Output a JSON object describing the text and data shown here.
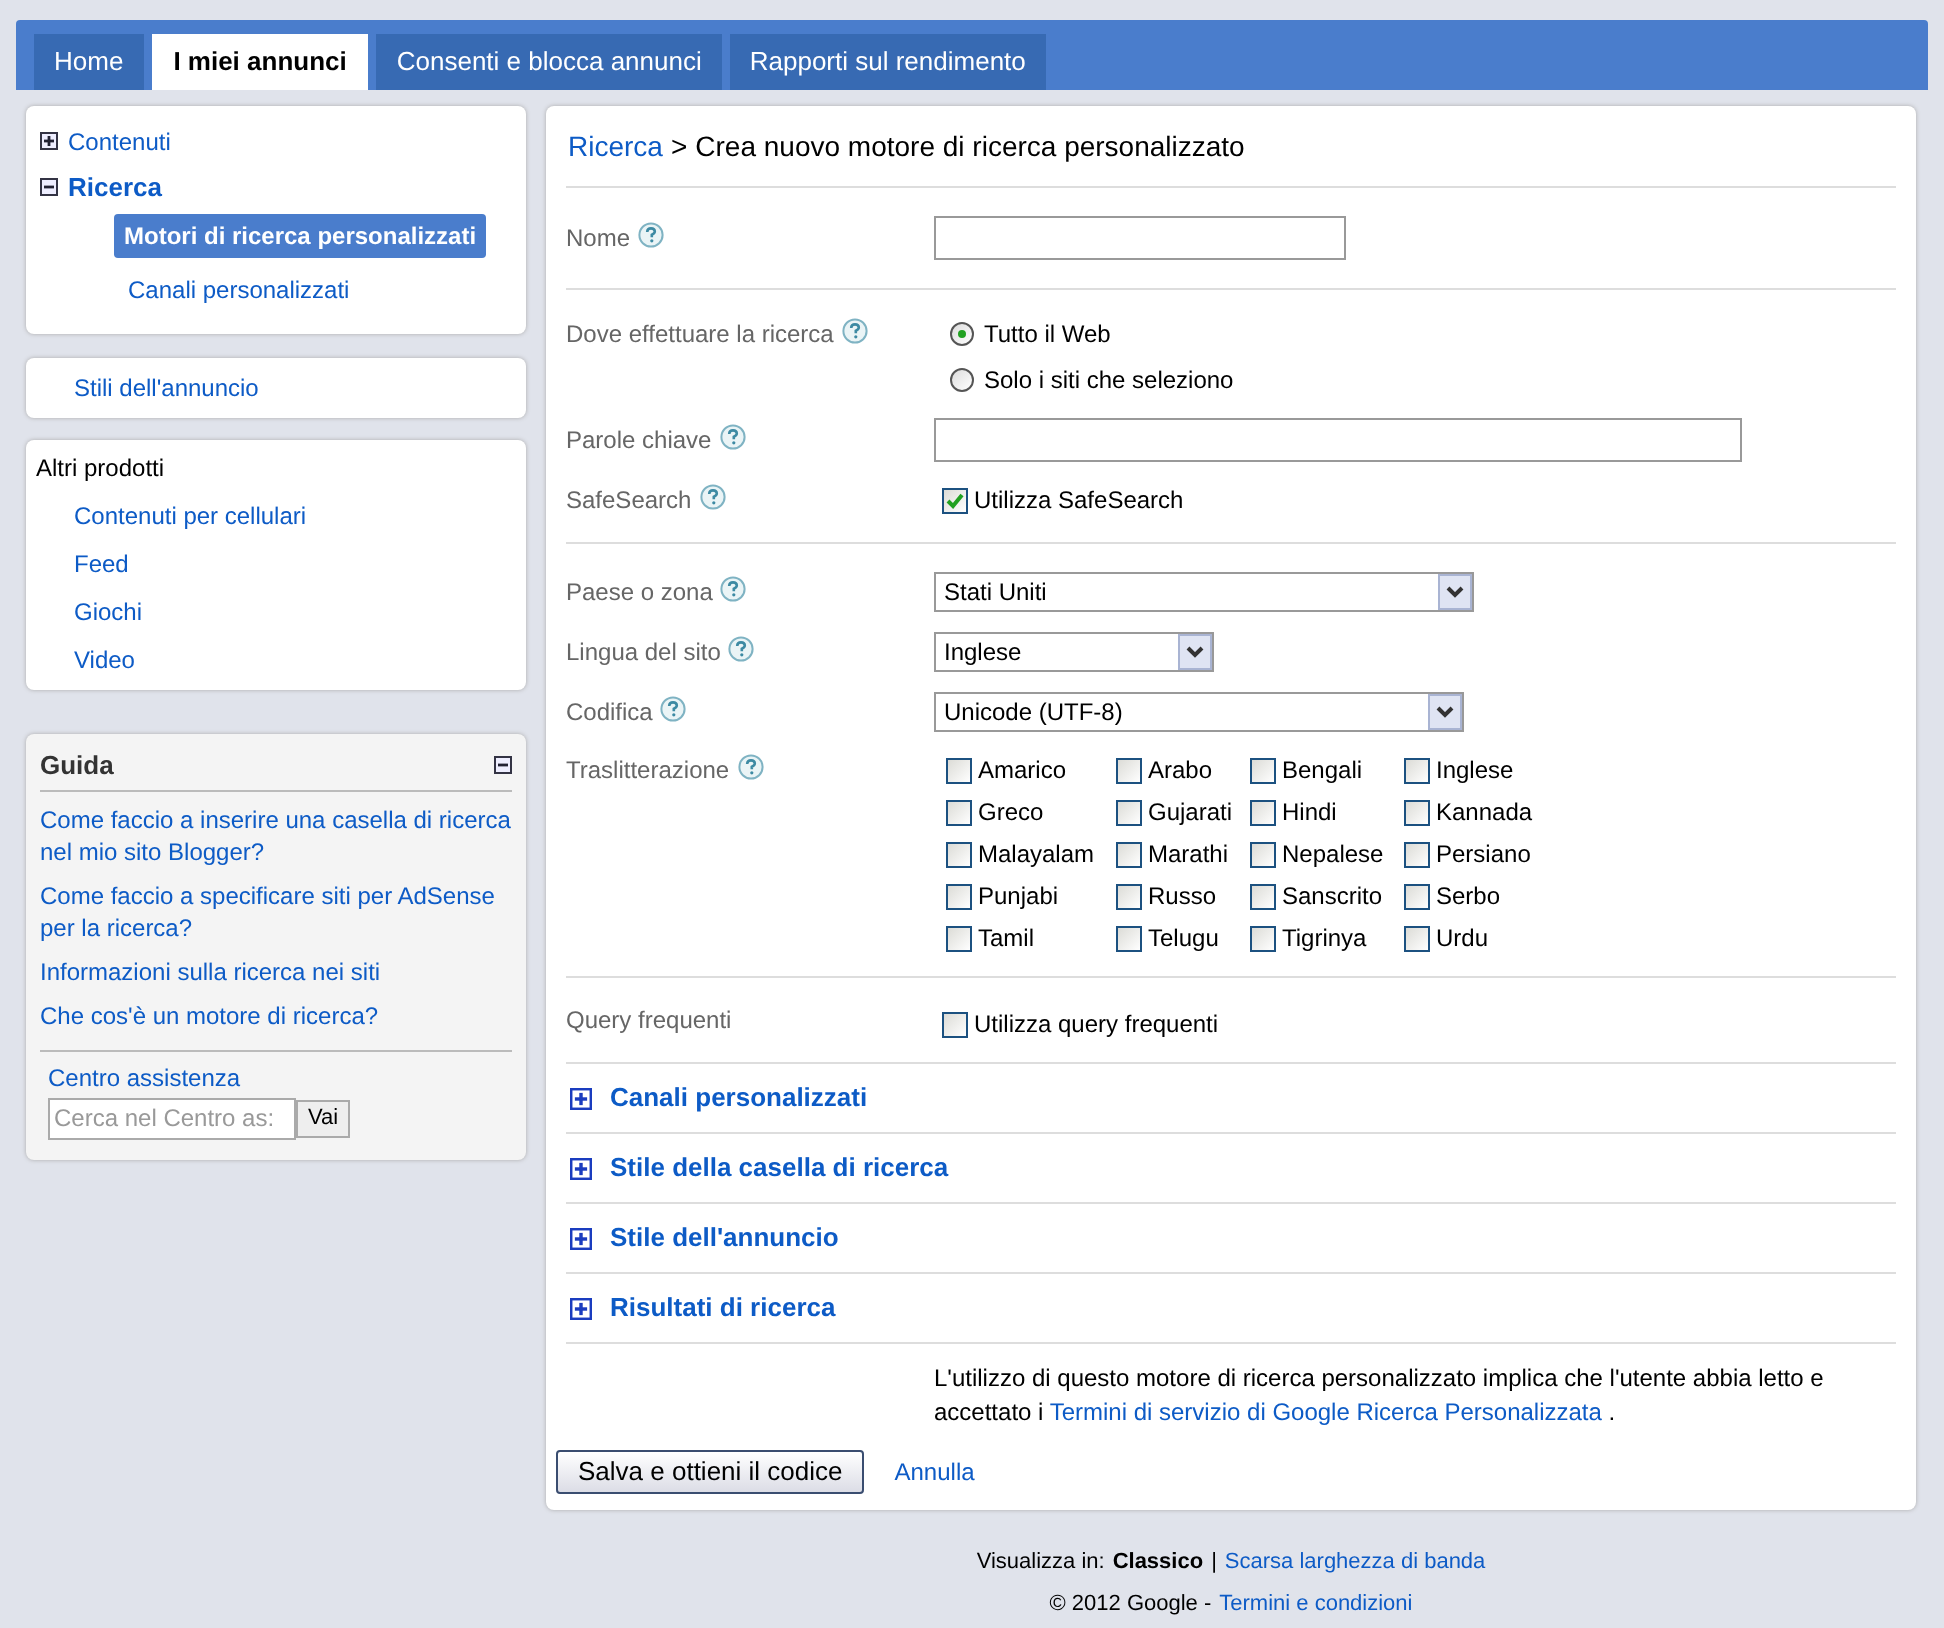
{
  "tabs": [
    {
      "label": "Home",
      "selected": false
    },
    {
      "label": "I miei annunci",
      "selected": true
    },
    {
      "label": "Consenti e blocca annunci",
      "selected": false
    },
    {
      "label": "Rapporti sul rendimento",
      "selected": false
    }
  ],
  "sidebar": {
    "nav": [
      {
        "label": "Contenuti",
        "expanded": false
      },
      {
        "label": "Ricerca",
        "expanded": true,
        "children": [
          {
            "label": "Motori di ricerca personalizzati",
            "selected": true
          },
          {
            "label": "Canali personalizzati",
            "selected": false
          }
        ]
      }
    ],
    "styles_link": "Stili dell'annuncio",
    "other_products": {
      "title": "Altri prodotti",
      "items": [
        "Contenuti per cellulari",
        "Feed",
        "Giochi",
        "Video"
      ]
    },
    "guide": {
      "title": "Guida",
      "expanded": true,
      "links": [
        "Come faccio a inserire una casella di ricerca nel mio sito Blogger?",
        "Come faccio a specificare siti per AdSense per la ricerca?",
        "Informazioni sulla ricerca nei siti",
        "Che cos'è un motore di ricerca?"
      ],
      "help_center": {
        "title": "Centro assistenza",
        "placeholder": "Cerca nel Centro as:",
        "button": "Vai"
      }
    }
  },
  "main": {
    "breadcrumb": {
      "link": "Ricerca",
      "separator": ">",
      "current": "Crea nuovo motore di ricerca personalizzato"
    },
    "name": {
      "label": "Nome"
    },
    "where": {
      "label": "Dove effettuare la ricerca",
      "options": [
        {
          "label": "Tutto il Web",
          "selected": true
        },
        {
          "label": "Solo i siti che seleziono",
          "selected": false
        }
      ]
    },
    "keywords": {
      "label": "Parole chiave"
    },
    "safesearch": {
      "label": "SafeSearch",
      "option": "Utilizza SafeSearch",
      "checked": true
    },
    "country": {
      "label": "Paese o zona",
      "value": "Stati Uniti"
    },
    "language": {
      "label": "Lingua del sito",
      "value": "Inglese"
    },
    "encoding": {
      "label": "Codifica",
      "value": "Unicode (UTF-8)"
    },
    "transliteration": {
      "label": "Traslitterazione",
      "languages": [
        {
          "label": "Amarico",
          "checked": false
        },
        {
          "label": "Arabo",
          "checked": false
        },
        {
          "label": "Bengali",
          "checked": false
        },
        {
          "label": "Inglese",
          "checked": false
        },
        {
          "label": "Greco",
          "checked": false
        },
        {
          "label": "Gujarati",
          "checked": false
        },
        {
          "label": "Hindi",
          "checked": false
        },
        {
          "label": "Kannada",
          "checked": false
        },
        {
          "label": "Malayalam",
          "checked": false
        },
        {
          "label": "Marathi",
          "checked": false
        },
        {
          "label": "Nepalese",
          "checked": false
        },
        {
          "label": "Persiano",
          "checked": false
        },
        {
          "label": "Punjabi",
          "checked": false
        },
        {
          "label": "Russo",
          "checked": false
        },
        {
          "label": "Sanscrito",
          "checked": false
        },
        {
          "label": "Serbo",
          "checked": false
        },
        {
          "label": "Tamil",
          "checked": false
        },
        {
          "label": "Telugu",
          "checked": false
        },
        {
          "label": "Tigrinya",
          "checked": false
        },
        {
          "label": "Urdu",
          "checked": false
        }
      ]
    },
    "frequent_queries": {
      "label": "Query frequenti",
      "option": "Utilizza query frequenti",
      "checked": false
    },
    "sections": [
      {
        "label": "Canali personalizzati",
        "expanded": false
      },
      {
        "label": "Stile della casella di ricerca",
        "expanded": false
      },
      {
        "label": "Stile dell'annuncio",
        "expanded": false
      },
      {
        "label": "Risultati di ricerca",
        "expanded": false
      }
    ],
    "terms": {
      "text": "L'utilizzo di questo motore di ricerca personalizzato implica che l'utente abbia letto e accettato i",
      "link": "Termini di servizio di Google Ricerca Personalizzata",
      "end": "."
    },
    "save_button": "Salva e ottieni il codice",
    "cancel_link": "Annulla"
  },
  "footer": {
    "view_label": "Visualizza in:",
    "current_view": "Classico",
    "separator": "|",
    "view_link": "Scarsa larghezza di banda",
    "copyright": "© 2012 Google -",
    "terms_link": "Termini e condizioni"
  }
}
